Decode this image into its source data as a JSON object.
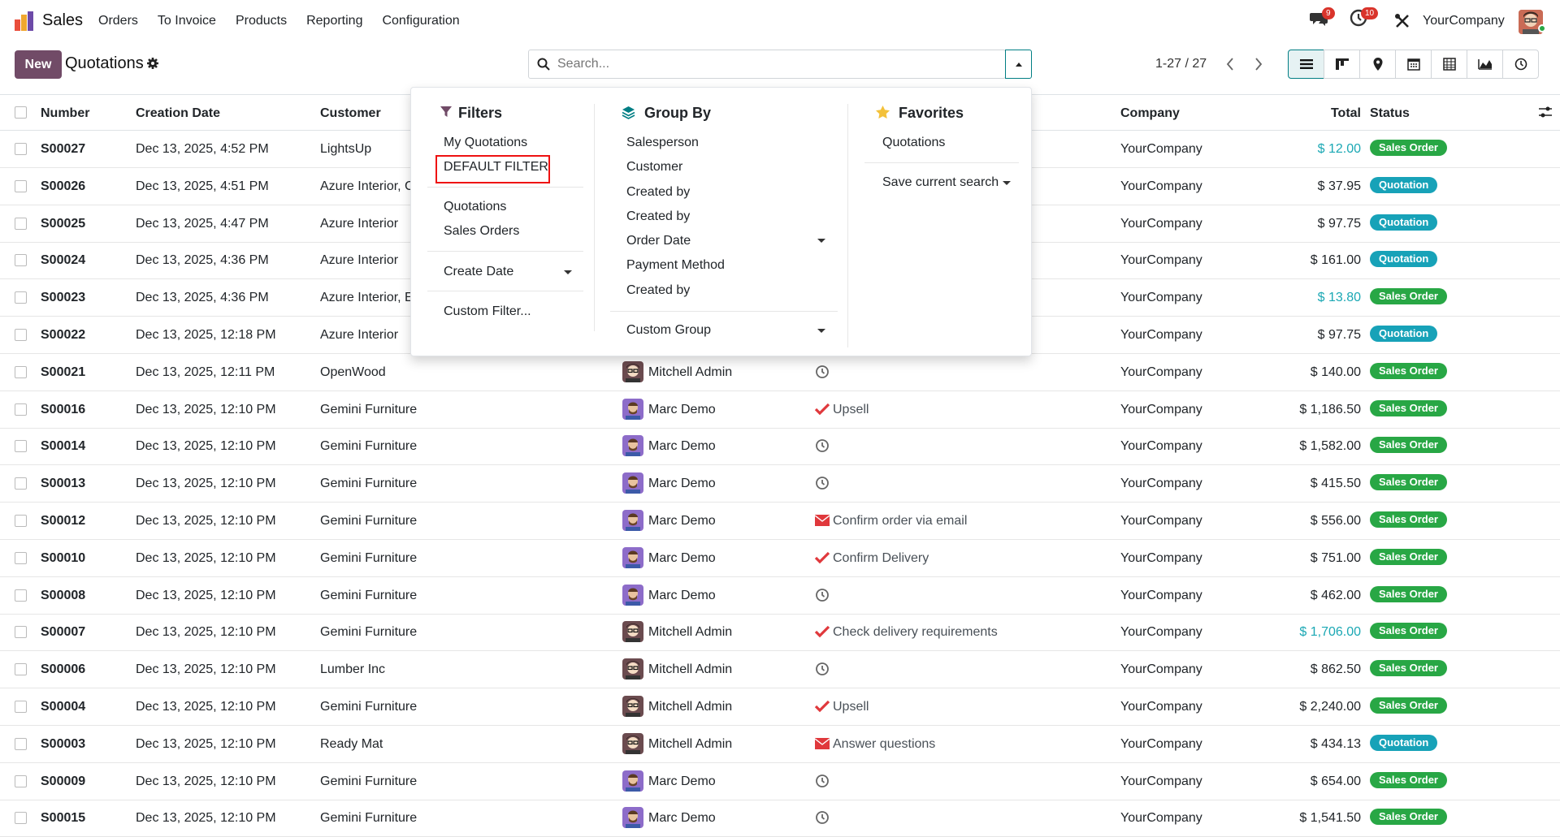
{
  "nav": {
    "app_name": "Sales",
    "menu": [
      "Orders",
      "To Invoice",
      "Products",
      "Reporting",
      "Configuration"
    ],
    "messages_count": "9",
    "activities_count": "10",
    "company": "YourCompany"
  },
  "control": {
    "new_label": "New",
    "title": "Quotations",
    "search_placeholder": "Search...",
    "pager": "1-27 / 27"
  },
  "columns": {
    "number": "Number",
    "creation_date": "Creation Date",
    "customer": "Customer",
    "company": "Company",
    "total": "Total",
    "status": "Status"
  },
  "rows": [
    {
      "number": "S00027",
      "date": "Dec 13, 2025, 4:52 PM",
      "customer": "LightsUp",
      "salesperson": "",
      "activity": "",
      "company": "YourCompany",
      "total": "$ 12.00",
      "total_teal": true,
      "status": "Sales Order"
    },
    {
      "number": "S00026",
      "date": "Dec 13, 2025, 4:51 PM",
      "customer": "Azure Interior, C",
      "salesperson": "",
      "activity": "",
      "company": "YourCompany",
      "total": "$ 37.95",
      "total_teal": false,
      "status": "Quotation"
    },
    {
      "number": "S00025",
      "date": "Dec 13, 2025, 4:47 PM",
      "customer": "Azure Interior",
      "salesperson": "",
      "activity": "",
      "company": "YourCompany",
      "total": "$ 97.75",
      "total_teal": false,
      "status": "Quotation"
    },
    {
      "number": "S00024",
      "date": "Dec 13, 2025, 4:36 PM",
      "customer": "Azure Interior",
      "salesperson": "",
      "activity": "",
      "company": "YourCompany",
      "total": "$ 161.00",
      "total_teal": false,
      "status": "Quotation"
    },
    {
      "number": "S00023",
      "date": "Dec 13, 2025, 4:36 PM",
      "customer": "Azure Interior, E",
      "salesperson": "",
      "activity": "",
      "company": "YourCompany",
      "total": "$ 13.80",
      "total_teal": true,
      "status": "Sales Order"
    },
    {
      "number": "S00022",
      "date": "Dec 13, 2025, 12:18 PM",
      "customer": "Azure Interior",
      "salesperson": "",
      "activity": "",
      "company": "YourCompany",
      "total": "$ 97.75",
      "total_teal": false,
      "status": "Quotation"
    },
    {
      "number": "S00021",
      "date": "Dec 13, 2025, 12:11 PM",
      "customer": "OpenWood",
      "salesperson": "Mitchell Admin",
      "sp_type": "mitchell",
      "act_type": "clock",
      "activity": "",
      "company": "YourCompany",
      "total": "$ 140.00",
      "total_teal": false,
      "status": "Sales Order"
    },
    {
      "number": "S00016",
      "date": "Dec 13, 2025, 12:10 PM",
      "customer": "Gemini Furniture",
      "salesperson": "Marc Demo",
      "sp_type": "marc",
      "act_type": "check",
      "activity": "Upsell",
      "company": "YourCompany",
      "total": "$ 1,186.50",
      "total_teal": false,
      "status": "Sales Order"
    },
    {
      "number": "S00014",
      "date": "Dec 13, 2025, 12:10 PM",
      "customer": "Gemini Furniture",
      "salesperson": "Marc Demo",
      "sp_type": "marc",
      "act_type": "clock",
      "activity": "",
      "company": "YourCompany",
      "total": "$ 1,582.00",
      "total_teal": false,
      "status": "Sales Order"
    },
    {
      "number": "S00013",
      "date": "Dec 13, 2025, 12:10 PM",
      "customer": "Gemini Furniture",
      "salesperson": "Marc Demo",
      "sp_type": "marc",
      "act_type": "clock",
      "activity": "",
      "company": "YourCompany",
      "total": "$ 415.50",
      "total_teal": false,
      "status": "Sales Order"
    },
    {
      "number": "S00012",
      "date": "Dec 13, 2025, 12:10 PM",
      "customer": "Gemini Furniture",
      "salesperson": "Marc Demo",
      "sp_type": "marc",
      "act_type": "mail",
      "activity": "Confirm order via email",
      "company": "YourCompany",
      "total": "$ 556.00",
      "total_teal": false,
      "status": "Sales Order"
    },
    {
      "number": "S00010",
      "date": "Dec 13, 2025, 12:10 PM",
      "customer": "Gemini Furniture",
      "salesperson": "Marc Demo",
      "sp_type": "marc",
      "act_type": "check",
      "activity": "Confirm Delivery",
      "company": "YourCompany",
      "total": "$ 751.00",
      "total_teal": false,
      "status": "Sales Order"
    },
    {
      "number": "S00008",
      "date": "Dec 13, 2025, 12:10 PM",
      "customer": "Gemini Furniture",
      "salesperson": "Marc Demo",
      "sp_type": "marc",
      "act_type": "clock",
      "activity": "",
      "company": "YourCompany",
      "total": "$ 462.00",
      "total_teal": false,
      "status": "Sales Order"
    },
    {
      "number": "S00007",
      "date": "Dec 13, 2025, 12:10 PM",
      "customer": "Gemini Furniture",
      "salesperson": "Mitchell Admin",
      "sp_type": "mitchell",
      "act_type": "check",
      "activity": "Check delivery requirements",
      "company": "YourCompany",
      "total": "$ 1,706.00",
      "total_teal": true,
      "status": "Sales Order"
    },
    {
      "number": "S00006",
      "date": "Dec 13, 2025, 12:10 PM",
      "customer": "Lumber Inc",
      "salesperson": "Mitchell Admin",
      "sp_type": "mitchell",
      "act_type": "clock",
      "activity": "",
      "company": "YourCompany",
      "total": "$ 862.50",
      "total_teal": false,
      "status": "Sales Order"
    },
    {
      "number": "S00004",
      "date": "Dec 13, 2025, 12:10 PM",
      "customer": "Gemini Furniture",
      "salesperson": "Mitchell Admin",
      "sp_type": "mitchell",
      "act_type": "check",
      "activity": "Upsell",
      "company": "YourCompany",
      "total": "$ 2,240.00",
      "total_teal": false,
      "status": "Sales Order"
    },
    {
      "number": "S00003",
      "date": "Dec 13, 2025, 12:10 PM",
      "customer": "Ready Mat",
      "salesperson": "Mitchell Admin",
      "sp_type": "mitchell",
      "act_type": "mail",
      "activity": "Answer questions",
      "company": "YourCompany",
      "total": "$ 434.13",
      "total_teal": false,
      "status": "Quotation"
    },
    {
      "number": "S00009",
      "date": "Dec 13, 2025, 12:10 PM",
      "customer": "Gemini Furniture",
      "salesperson": "Marc Demo",
      "sp_type": "marc",
      "act_type": "clock",
      "activity": "",
      "company": "YourCompany",
      "total": "$ 654.00",
      "total_teal": false,
      "status": "Sales Order"
    },
    {
      "number": "S00015",
      "date": "Dec 13, 2025, 12:10 PM",
      "customer": "Gemini Furniture",
      "salesperson": "Marc Demo",
      "sp_type": "marc",
      "act_type": "clock",
      "activity": "",
      "company": "YourCompany",
      "total": "$ 1,541.50",
      "total_teal": false,
      "status": "Sales Order"
    }
  ],
  "dropdown": {
    "filters": {
      "title": "Filters",
      "items": [
        "My Quotations",
        "DEFAULT FILTER",
        "Quotations",
        "Sales Orders",
        "Create Date",
        "Custom Filter..."
      ]
    },
    "group_by": {
      "title": "Group By",
      "items": [
        "Salesperson",
        "Customer",
        "Created by",
        "Created by",
        "Order Date",
        "Payment Method",
        "Created by",
        "Custom Group"
      ]
    },
    "favorites": {
      "title": "Favorites",
      "items": [
        "Quotations",
        "Save current search"
      ]
    }
  },
  "colors": {
    "brand": "#714b67",
    "teal": "#017e84",
    "sales_order": "#28a745",
    "quotation": "#17a2b8"
  }
}
